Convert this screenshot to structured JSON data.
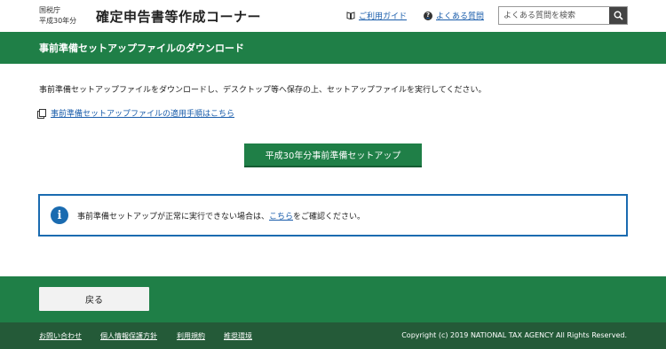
{
  "header": {
    "agency": "国税庁",
    "year": "平成30年分",
    "title": "確定申告書等作成コーナー",
    "guide_link": "ご利用ガイド",
    "faq_link": "よくある質問",
    "search_placeholder": "よくある質問を検索"
  },
  "band": {
    "title": "事前準備セットアップファイルのダウンロード"
  },
  "main": {
    "description": "事前準備セットアップファイルをダウンロードし、デスクトップ等へ保存の上、セットアップファイルを実行してください。",
    "procedure_link": "事前準備セットアップファイルの適用手順はこちら",
    "download_button": "平成30年分事前準備セットアップ",
    "info_prefix": "事前準備セットアップが正常に実行できない場合は、",
    "info_link": "こちら",
    "info_suffix": "をご確認ください。"
  },
  "footer": {
    "back_button": "戻る",
    "links": [
      "お問い合わせ",
      "個人情報保護方針",
      "利用規約",
      "推奨環境"
    ],
    "copyright": "Copyright (c) 2019 NATIONAL TAX AGENCY All Rights Reserved."
  },
  "colors": {
    "brand_green": "#1f7f47",
    "footer_dark": "#245a38",
    "link_blue": "#1a5dab",
    "info_blue": "#1a6bb0"
  }
}
